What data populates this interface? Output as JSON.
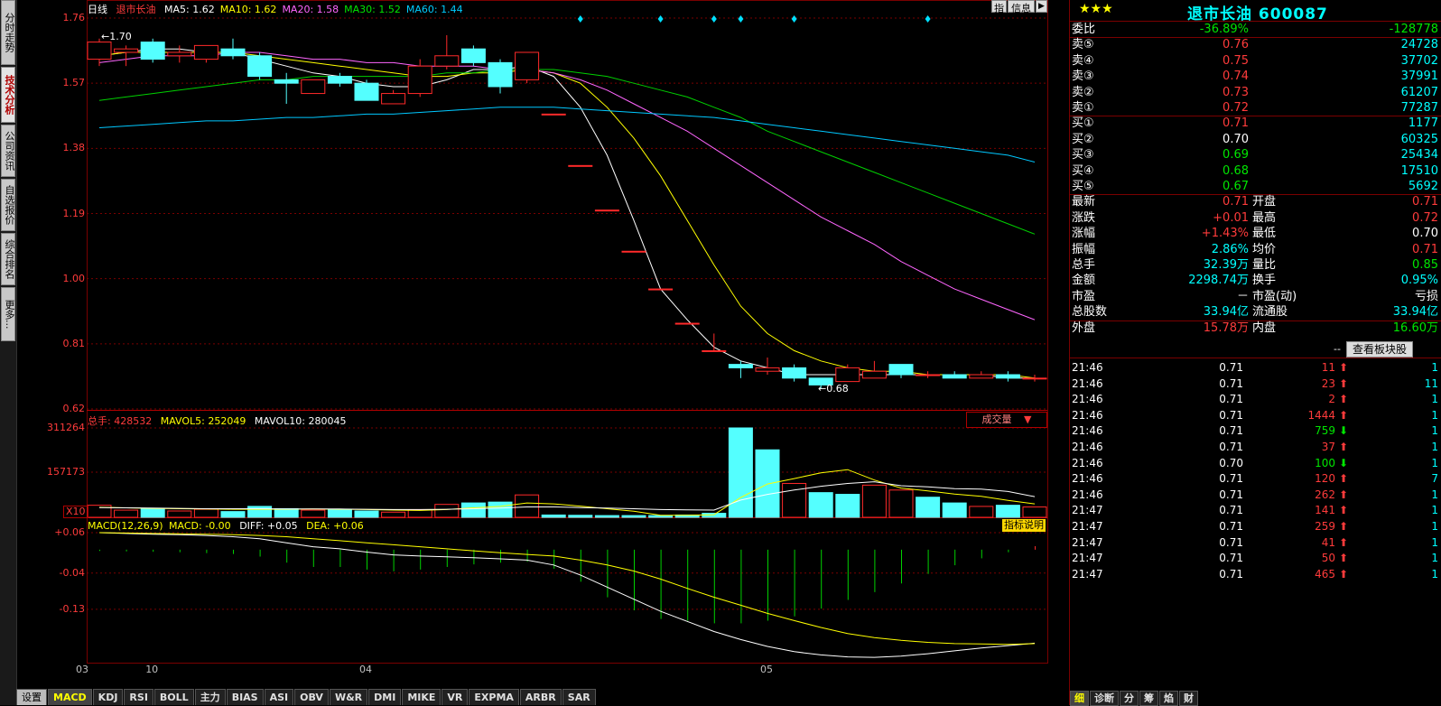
{
  "sidebar": {
    "tabs": [
      {
        "label": "分时走势",
        "active": false
      },
      {
        "label": "技术分析",
        "active": true
      },
      {
        "label": "公司资讯",
        "active": false
      },
      {
        "label": "自选报价",
        "active": false
      },
      {
        "label": "综合排名",
        "active": false
      },
      {
        "label": "更多...",
        "active": false
      }
    ]
  },
  "chart": {
    "period_label": "日线",
    "stock_name": "退市长油",
    "ma_legend": [
      {
        "label": "MA5: 1.62",
        "color": "#ffffff"
      },
      {
        "label": "MA10: 1.62",
        "color": "#ffff00"
      },
      {
        "label": "MA20: 1.58",
        "color": "#ff66ff"
      },
      {
        "label": "MA30: 1.52",
        "color": "#00e600"
      },
      {
        "label": "MA60: 1.44",
        "color": "#00ccff"
      }
    ],
    "top_buttons": {
      "tip": "指",
      "info": "信息"
    },
    "price_axis": [
      "1.76",
      "1.57",
      "1.38",
      "1.19",
      "1.00",
      "0.81",
      "0.62"
    ],
    "high_marker": "←1.70",
    "low_marker": "←0.68",
    "volume_header": {
      "total": "总手: 428532",
      "mavol5": "MAVOL5: 252049",
      "mavol10": "MAVOL10: 280045"
    },
    "volume_select": "成交量",
    "volume_axis": [
      "311264",
      "157173"
    ],
    "volume_unit": "X10",
    "macd_header": {
      "name": "MACD(12,26,9)",
      "macd": "MACD: -0.00",
      "diff": "DIFF: +0.05",
      "dea": "DEA: +0.06"
    },
    "macd_help": "指标说明",
    "macd_axis": [
      "+0.06",
      "-0.04",
      "-0.13"
    ],
    "date_labels": [
      {
        "text": "03",
        "day": 0
      },
      {
        "text": "10",
        "day": 2
      },
      {
        "text": "04",
        "day": 10
      },
      {
        "text": "05",
        "day": 25
      }
    ]
  },
  "chart_data": {
    "type": "candlestick",
    "ylim": [
      0.62,
      1.76
    ],
    "candles": [
      {
        "o": 1.64,
        "c": 1.69,
        "h": 1.7,
        "l": 1.62
      },
      {
        "o": 1.66,
        "c": 1.67,
        "h": 1.68,
        "l": 1.62
      },
      {
        "o": 1.69,
        "c": 1.64,
        "h": 1.7,
        "l": 1.63
      },
      {
        "o": 1.65,
        "c": 1.66,
        "h": 1.68,
        "l": 1.63
      },
      {
        "o": 1.64,
        "c": 1.68,
        "h": 1.68,
        "l": 1.63
      },
      {
        "o": 1.67,
        "c": 1.65,
        "h": 1.7,
        "l": 1.64
      },
      {
        "o": 1.65,
        "c": 1.59,
        "h": 1.66,
        "l": 1.58
      },
      {
        "o": 1.58,
        "c": 1.57,
        "h": 1.6,
        "l": 1.51
      },
      {
        "o": 1.54,
        "c": 1.58,
        "h": 1.58,
        "l": 1.54
      },
      {
        "o": 1.59,
        "c": 1.57,
        "h": 1.6,
        "l": 1.56
      },
      {
        "o": 1.57,
        "c": 1.52,
        "h": 1.58,
        "l": 1.52
      },
      {
        "o": 1.51,
        "c": 1.54,
        "h": 1.55,
        "l": 1.51
      },
      {
        "o": 1.54,
        "c": 1.62,
        "h": 1.64,
        "l": 1.53
      },
      {
        "o": 1.62,
        "c": 1.65,
        "h": 1.71,
        "l": 1.61
      },
      {
        "o": 1.67,
        "c": 1.63,
        "h": 1.68,
        "l": 1.62
      },
      {
        "o": 1.63,
        "c": 1.56,
        "h": 1.64,
        "l": 1.54
      },
      {
        "o": 1.58,
        "c": 1.66,
        "h": 1.66,
        "l": 1.57
      },
      {
        "o": 1.48,
        "c": 1.48,
        "h": 1.48,
        "l": 1.48
      },
      {
        "o": 1.33,
        "c": 1.33,
        "h": 1.33,
        "l": 1.33
      },
      {
        "o": 1.2,
        "c": 1.2,
        "h": 1.2,
        "l": 1.2
      },
      {
        "o": 1.08,
        "c": 1.08,
        "h": 1.08,
        "l": 1.08
      },
      {
        "o": 0.97,
        "c": 0.97,
        "h": 0.97,
        "l": 0.97
      },
      {
        "o": 0.87,
        "c": 0.87,
        "h": 0.87,
        "l": 0.87
      },
      {
        "o": 0.79,
        "c": 0.79,
        "h": 0.84,
        "l": 0.79
      },
      {
        "o": 0.75,
        "c": 0.74,
        "h": 0.76,
        "l": 0.71
      },
      {
        "o": 0.73,
        "c": 0.74,
        "h": 0.77,
        "l": 0.72
      },
      {
        "o": 0.74,
        "c": 0.71,
        "h": 0.75,
        "l": 0.7
      },
      {
        "o": 0.71,
        "c": 0.69,
        "h": 0.71,
        "l": 0.68
      },
      {
        "o": 0.7,
        "c": 0.74,
        "h": 0.75,
        "l": 0.7
      },
      {
        "o": 0.71,
        "c": 0.73,
        "h": 0.76,
        "l": 0.71
      },
      {
        "o": 0.75,
        "c": 0.72,
        "h": 0.75,
        "l": 0.71
      },
      {
        "o": 0.72,
        "c": 0.72,
        "h": 0.73,
        "l": 0.71
      },
      {
        "o": 0.72,
        "c": 0.71,
        "h": 0.73,
        "l": 0.71
      },
      {
        "o": 0.71,
        "c": 0.72,
        "h": 0.73,
        "l": 0.71
      },
      {
        "o": 0.72,
        "c": 0.71,
        "h": 0.73,
        "l": 0.7
      },
      {
        "o": 0.71,
        "c": 0.71,
        "h": 0.72,
        "l": 0.7
      }
    ],
    "ma": {
      "MA5": [
        1.65,
        1.66,
        1.67,
        1.67,
        1.66,
        1.66,
        1.64,
        1.62,
        1.6,
        1.59,
        1.57,
        1.56,
        1.56,
        1.58,
        1.61,
        1.61,
        1.62,
        1.59,
        1.5,
        1.36,
        1.17,
        0.97,
        0.88,
        0.8,
        0.76,
        0.74,
        0.72,
        0.72,
        0.72,
        0.72,
        0.72,
        0.72,
        0.72,
        0.72,
        0.71,
        0.71
      ],
      "MA10": [
        1.65,
        1.66,
        1.66,
        1.66,
        1.66,
        1.66,
        1.65,
        1.64,
        1.63,
        1.62,
        1.61,
        1.6,
        1.59,
        1.59,
        1.6,
        1.6,
        1.61,
        1.6,
        1.57,
        1.5,
        1.41,
        1.3,
        1.17,
        1.04,
        0.92,
        0.84,
        0.79,
        0.76,
        0.74,
        0.73,
        0.73,
        0.72,
        0.72,
        0.72,
        0.72,
        0.71
      ],
      "MA20": [
        1.63,
        1.64,
        1.65,
        1.65,
        1.65,
        1.66,
        1.66,
        1.65,
        1.64,
        1.64,
        1.63,
        1.63,
        1.62,
        1.62,
        1.62,
        1.61,
        1.61,
        1.6,
        1.58,
        1.55,
        1.51,
        1.47,
        1.43,
        1.38,
        1.33,
        1.28,
        1.23,
        1.18,
        1.14,
        1.1,
        1.05,
        1.01,
        0.97,
        0.94,
        0.91,
        0.88
      ],
      "MA30": [
        1.52,
        1.53,
        1.54,
        1.55,
        1.56,
        1.57,
        1.58,
        1.58,
        1.59,
        1.59,
        1.59,
        1.59,
        1.59,
        1.6,
        1.6,
        1.61,
        1.61,
        1.61,
        1.6,
        1.59,
        1.57,
        1.55,
        1.53,
        1.5,
        1.47,
        1.43,
        1.4,
        1.37,
        1.34,
        1.31,
        1.28,
        1.25,
        1.22,
        1.19,
        1.16,
        1.13
      ],
      "MA60": [
        1.44,
        1.445,
        1.45,
        1.455,
        1.46,
        1.46,
        1.465,
        1.47,
        1.47,
        1.475,
        1.48,
        1.48,
        1.485,
        1.49,
        1.495,
        1.5,
        1.5,
        1.5,
        1.495,
        1.49,
        1.485,
        1.48,
        1.475,
        1.47,
        1.46,
        1.45,
        1.44,
        1.43,
        1.42,
        1.41,
        1.4,
        1.39,
        1.38,
        1.37,
        1.36,
        1.34
      ]
    },
    "volume": {
      "ylim": [
        0,
        311264
      ],
      "values": [
        42000,
        25000,
        30000,
        22000,
        28000,
        20000,
        38000,
        30000,
        25000,
        27000,
        22000,
        18000,
        26000,
        45000,
        50000,
        53000,
        78000,
        8000,
        7000,
        6000,
        6000,
        6000,
        8000,
        14000,
        311264,
        235000,
        118000,
        86000,
        80000,
        112000,
        95000,
        70000,
        50000,
        38000,
        42000,
        36000
      ],
      "up": [
        true,
        true,
        false,
        true,
        true,
        false,
        false,
        false,
        true,
        false,
        false,
        true,
        true,
        true,
        false,
        false,
        true,
        false,
        false,
        false,
        false,
        false,
        false,
        false,
        false,
        false,
        true,
        false,
        false,
        true,
        true,
        false,
        false,
        true,
        false,
        true
      ],
      "mavol5": [
        35000,
        33000,
        31000,
        30000,
        29000,
        28000,
        28000,
        28000,
        29000,
        28000,
        27000,
        25000,
        24000,
        27000,
        33000,
        38000,
        50000,
        47000,
        39000,
        30000,
        21000,
        7000,
        7000,
        9000,
        69000,
        116000,
        135000,
        155000,
        166000,
        130000,
        102000,
        92000,
        81000,
        73000,
        59000,
        47000
      ],
      "mavol10": [
        34000,
        33000,
        32000,
        31000,
        30000,
        30000,
        30000,
        29000,
        29000,
        29000,
        28000,
        27000,
        27000,
        28000,
        30000,
        32000,
        36000,
        36000,
        34000,
        32000,
        30000,
        27000,
        26000,
        25000,
        60000,
        80000,
        95000,
        108000,
        118000,
        124000,
        110000,
        106000,
        100000,
        98000,
        90000,
        72000
      ]
    },
    "macd": {
      "ylim": [
        -0.26,
        0.06
      ],
      "diff": [
        0.06,
        0.058,
        0.056,
        0.055,
        0.053,
        0.05,
        0.045,
        0.035,
        0.025,
        0.02,
        0.012,
        0.005,
        0.002,
        0.0,
        -0.002,
        -0.005,
        -0.008,
        -0.02,
        -0.045,
        -0.075,
        -0.105,
        -0.135,
        -0.16,
        -0.185,
        -0.205,
        -0.222,
        -0.235,
        -0.243,
        -0.248,
        -0.249,
        -0.246,
        -0.24,
        -0.233,
        -0.226,
        -0.22,
        -0.214
      ],
      "dea": [
        0.06,
        0.059,
        0.058,
        0.057,
        0.056,
        0.055,
        0.053,
        0.05,
        0.045,
        0.04,
        0.035,
        0.03,
        0.025,
        0.02,
        0.015,
        0.01,
        0.006,
        0.002,
        -0.008,
        -0.02,
        -0.035,
        -0.055,
        -0.078,
        -0.1,
        -0.12,
        -0.14,
        -0.158,
        -0.175,
        -0.19,
        -0.2,
        -0.207,
        -0.212,
        -0.215,
        -0.216,
        -0.217,
        -0.215
      ],
      "hist": [
        -0.003,
        -0.004,
        -0.005,
        -0.006,
        -0.008,
        -0.01,
        -0.016,
        -0.03,
        -0.04,
        -0.04,
        -0.046,
        -0.05,
        -0.046,
        -0.04,
        -0.034,
        -0.03,
        -0.028,
        -0.044,
        -0.074,
        -0.11,
        -0.14,
        -0.16,
        -0.164,
        -0.17,
        -0.17,
        -0.164,
        -0.154,
        -0.136,
        -0.116,
        -0.098,
        -0.078,
        -0.056,
        -0.036,
        -0.02,
        -0.006,
        0.008
      ]
    }
  },
  "panel": {
    "title": "退市长油 600087",
    "stars": "★★★",
    "webi": {
      "label": "委比",
      "pct": "-36.89%",
      "diff": "-128778"
    },
    "sells": [
      {
        "label": "卖⑤",
        "price": "0.76",
        "vol": "24728"
      },
      {
        "label": "卖④",
        "price": "0.75",
        "vol": "37702"
      },
      {
        "label": "卖③",
        "price": "0.74",
        "vol": "37991"
      },
      {
        "label": "卖②",
        "price": "0.73",
        "vol": "61207"
      },
      {
        "label": "卖①",
        "price": "0.72",
        "vol": "77287"
      }
    ],
    "buys": [
      {
        "label": "买①",
        "price": "0.71",
        "vol": "1177",
        "color": "red"
      },
      {
        "label": "买②",
        "price": "0.70",
        "vol": "60325",
        "color": "white"
      },
      {
        "label": "买③",
        "price": "0.69",
        "vol": "25434",
        "color": "green"
      },
      {
        "label": "买④",
        "price": "0.68",
        "vol": "17510",
        "color": "green"
      },
      {
        "label": "买⑤",
        "price": "0.67",
        "vol": "5692",
        "color": "green"
      }
    ],
    "stats": [
      {
        "l1": "最新",
        "v1": "0.71",
        "c1": "red",
        "l2": "开盘",
        "v2": "0.71",
        "c2": "red"
      },
      {
        "l1": "涨跌",
        "v1": "+0.01",
        "c1": "red",
        "l2": "最高",
        "v2": "0.72",
        "c2": "red"
      },
      {
        "l1": "涨幅",
        "v1": "+1.43%",
        "c1": "red",
        "l2": "最低",
        "v2": "0.70",
        "c2": "white"
      },
      {
        "l1": "振幅",
        "v1": "2.86%",
        "c1": "cyan",
        "l2": "均价",
        "v2": "0.71",
        "c2": "red"
      },
      {
        "l1": "总手",
        "v1": "32.39万",
        "c1": "cyan",
        "l2": "量比",
        "v2": "0.85",
        "c2": "green"
      },
      {
        "l1": "金额",
        "v1": "2298.74万",
        "c1": "cyan",
        "l2": "换手",
        "v2": "0.95%",
        "c2": "cyan"
      },
      {
        "l1": "市盈",
        "v1": "－",
        "c1": "white",
        "l2": "市盈(动)",
        "v2": "亏损",
        "c2": "white"
      },
      {
        "l1": "总股数",
        "v1": "33.94亿",
        "c1": "cyan",
        "l2": "流通股",
        "v2": "33.94亿",
        "c2": "cyan"
      }
    ],
    "outer": {
      "l1": "外盘",
      "v1": "15.78万",
      "l2": "内盘",
      "v2": "16.60万"
    },
    "sector_button": "查看板块股",
    "sector_dash": "--",
    "ticks": [
      {
        "time": "21:46",
        "price": "0.71",
        "vol": "11",
        "dir": "up",
        "n": "1",
        "pc": "white"
      },
      {
        "time": "21:46",
        "price": "0.71",
        "vol": "23",
        "dir": "up",
        "n": "11",
        "pc": "white"
      },
      {
        "time": "21:46",
        "price": "0.71",
        "vol": "2",
        "dir": "up",
        "n": "1",
        "pc": "white"
      },
      {
        "time": "21:46",
        "price": "0.71",
        "vol": "1444",
        "dir": "up",
        "n": "1",
        "pc": "white"
      },
      {
        "time": "21:46",
        "price": "0.71",
        "vol": "759",
        "dir": "down",
        "n": "1",
        "pc": "white"
      },
      {
        "time": "21:46",
        "price": "0.71",
        "vol": "37",
        "dir": "up",
        "n": "1",
        "pc": "white"
      },
      {
        "time": "21:46",
        "price": "0.70",
        "vol": "100",
        "dir": "down",
        "n": "1",
        "pc": "white"
      },
      {
        "time": "21:46",
        "price": "0.71",
        "vol": "120",
        "dir": "up",
        "n": "7",
        "pc": "white"
      },
      {
        "time": "21:46",
        "price": "0.71",
        "vol": "262",
        "dir": "up",
        "n": "1",
        "pc": "white"
      },
      {
        "time": "21:47",
        "price": "0.71",
        "vol": "141",
        "dir": "up",
        "n": "1",
        "pc": "white"
      },
      {
        "time": "21:47",
        "price": "0.71",
        "vol": "259",
        "dir": "up",
        "n": "1",
        "pc": "white"
      },
      {
        "time": "21:47",
        "price": "0.71",
        "vol": "41",
        "dir": "up",
        "n": "1",
        "pc": "white"
      },
      {
        "time": "21:47",
        "price": "0.71",
        "vol": "50",
        "dir": "up",
        "n": "1",
        "pc": "white"
      },
      {
        "time": "21:47",
        "price": "0.71",
        "vol": "465",
        "dir": "up",
        "n": "1",
        "pc": "white"
      }
    ],
    "bottom_tabs": [
      "细",
      "诊断",
      "分",
      "筹",
      "焰",
      "财"
    ]
  },
  "bottom_tabs": {
    "setup": "设置",
    "tabs": [
      "MACD",
      "KDJ",
      "RSI",
      "BOLL",
      "主力",
      "BIAS",
      "ASI",
      "OBV",
      "W&R",
      "DMI",
      "MIKE",
      "VR",
      "EXPMA",
      "ARBR",
      "SAR"
    ],
    "active": "MACD"
  }
}
